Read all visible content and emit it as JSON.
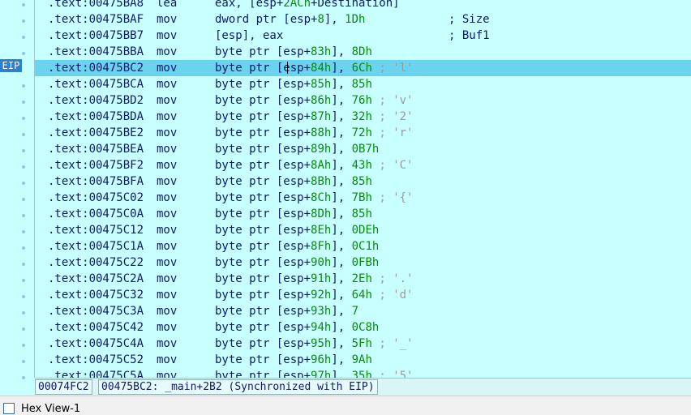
{
  "eip_label": "EIP",
  "rows": [
    {
      "addr": ".text:00475BA8",
      "mn": "lea",
      "ops": [
        {
          "t": "eax, [esp+",
          "c": "reg"
        },
        {
          "t": "2ACh",
          "c": "num"
        },
        {
          "t": "+Destination]",
          "c": "reg"
        }
      ],
      "cmt": ""
    },
    {
      "addr": ".text:00475BAF",
      "mn": "mov",
      "ops": [
        {
          "t": "dword ptr [esp+",
          "c": "reg"
        },
        {
          "t": "8",
          "c": "num"
        },
        {
          "t": "], ",
          "c": "reg"
        },
        {
          "t": "1Dh",
          "c": "num"
        }
      ],
      "far": "; Size"
    },
    {
      "addr": ".text:00475BB7",
      "mn": "mov",
      "ops": [
        {
          "t": "[esp], eax",
          "c": "reg"
        }
      ],
      "far": "; Buf1"
    },
    {
      "addr": ".text:00475BBA",
      "mn": "mov",
      "ops": [
        {
          "t": "byte ptr [esp+",
          "c": "reg"
        },
        {
          "t": "83h",
          "c": "num"
        },
        {
          "t": "], ",
          "c": "reg"
        },
        {
          "t": "8Dh",
          "c": "num"
        }
      ],
      "cmt": ""
    },
    {
      "addr": ".text:00475BC2",
      "mn": "mov",
      "ops": [
        {
          "t": "byte ptr [esp+",
          "c": "reg"
        },
        {
          "t": "84h",
          "c": "num"
        },
        {
          "t": "], ",
          "c": "reg"
        },
        {
          "t": "6Ch",
          "c": "num"
        }
      ],
      "cmt": " ; 'l'",
      "current": true
    },
    {
      "addr": ".text:00475BCA",
      "mn": "mov",
      "ops": [
        {
          "t": "byte ptr [esp+",
          "c": "reg"
        },
        {
          "t": "85h",
          "c": "num"
        },
        {
          "t": "], ",
          "c": "reg"
        },
        {
          "t": "85h",
          "c": "num"
        }
      ],
      "cmt": ""
    },
    {
      "addr": ".text:00475BD2",
      "mn": "mov",
      "ops": [
        {
          "t": "byte ptr [esp+",
          "c": "reg"
        },
        {
          "t": "86h",
          "c": "num"
        },
        {
          "t": "], ",
          "c": "reg"
        },
        {
          "t": "76h",
          "c": "num"
        }
      ],
      "cmt": " ; 'v'"
    },
    {
      "addr": ".text:00475BDA",
      "mn": "mov",
      "ops": [
        {
          "t": "byte ptr [esp+",
          "c": "reg"
        },
        {
          "t": "87h",
          "c": "num"
        },
        {
          "t": "], ",
          "c": "reg"
        },
        {
          "t": "32h",
          "c": "num"
        }
      ],
      "cmt": " ; '2'"
    },
    {
      "addr": ".text:00475BE2",
      "mn": "mov",
      "ops": [
        {
          "t": "byte ptr [esp+",
          "c": "reg"
        },
        {
          "t": "88h",
          "c": "num"
        },
        {
          "t": "], ",
          "c": "reg"
        },
        {
          "t": "72h",
          "c": "num"
        }
      ],
      "cmt": " ; 'r'"
    },
    {
      "addr": ".text:00475BEA",
      "mn": "mov",
      "ops": [
        {
          "t": "byte ptr [esp+",
          "c": "reg"
        },
        {
          "t": "89h",
          "c": "num"
        },
        {
          "t": "], ",
          "c": "reg"
        },
        {
          "t": "0B7h",
          "c": "num"
        }
      ],
      "cmt": ""
    },
    {
      "addr": ".text:00475BF2",
      "mn": "mov",
      "ops": [
        {
          "t": "byte ptr [esp+",
          "c": "reg"
        },
        {
          "t": "8Ah",
          "c": "num"
        },
        {
          "t": "], ",
          "c": "reg"
        },
        {
          "t": "43h",
          "c": "num"
        }
      ],
      "cmt": " ; 'C'"
    },
    {
      "addr": ".text:00475BFA",
      "mn": "mov",
      "ops": [
        {
          "t": "byte ptr [esp+",
          "c": "reg"
        },
        {
          "t": "8Bh",
          "c": "num"
        },
        {
          "t": "], ",
          "c": "reg"
        },
        {
          "t": "85h",
          "c": "num"
        }
      ],
      "cmt": ""
    },
    {
      "addr": ".text:00475C02",
      "mn": "mov",
      "ops": [
        {
          "t": "byte ptr [esp+",
          "c": "reg"
        },
        {
          "t": "8Ch",
          "c": "num"
        },
        {
          "t": "], ",
          "c": "reg"
        },
        {
          "t": "7Bh",
          "c": "num"
        }
      ],
      "cmt": " ; '{'"
    },
    {
      "addr": ".text:00475C0A",
      "mn": "mov",
      "ops": [
        {
          "t": "byte ptr [esp+",
          "c": "reg"
        },
        {
          "t": "8Dh",
          "c": "num"
        },
        {
          "t": "], ",
          "c": "reg"
        },
        {
          "t": "85h",
          "c": "num"
        }
      ],
      "cmt": ""
    },
    {
      "addr": ".text:00475C12",
      "mn": "mov",
      "ops": [
        {
          "t": "byte ptr [esp+",
          "c": "reg"
        },
        {
          "t": "8Eh",
          "c": "num"
        },
        {
          "t": "], ",
          "c": "reg"
        },
        {
          "t": "0DEh",
          "c": "num"
        }
      ],
      "cmt": ""
    },
    {
      "addr": ".text:00475C1A",
      "mn": "mov",
      "ops": [
        {
          "t": "byte ptr [esp+",
          "c": "reg"
        },
        {
          "t": "8Fh",
          "c": "num"
        },
        {
          "t": "], ",
          "c": "reg"
        },
        {
          "t": "0C1h",
          "c": "num"
        }
      ],
      "cmt": ""
    },
    {
      "addr": ".text:00475C22",
      "mn": "mov",
      "ops": [
        {
          "t": "byte ptr [esp+",
          "c": "reg"
        },
        {
          "t": "90h",
          "c": "num"
        },
        {
          "t": "], ",
          "c": "reg"
        },
        {
          "t": "0FBh",
          "c": "num"
        }
      ],
      "cmt": ""
    },
    {
      "addr": ".text:00475C2A",
      "mn": "mov",
      "ops": [
        {
          "t": "byte ptr [esp+",
          "c": "reg"
        },
        {
          "t": "91h",
          "c": "num"
        },
        {
          "t": "], ",
          "c": "reg"
        },
        {
          "t": "2Eh",
          "c": "num"
        }
      ],
      "cmt": " ; '.'"
    },
    {
      "addr": ".text:00475C32",
      "mn": "mov",
      "ops": [
        {
          "t": "byte ptr [esp+",
          "c": "reg"
        },
        {
          "t": "92h",
          "c": "num"
        },
        {
          "t": "], ",
          "c": "reg"
        },
        {
          "t": "64h",
          "c": "num"
        }
      ],
      "cmt": " ; 'd'"
    },
    {
      "addr": ".text:00475C3A",
      "mn": "mov",
      "ops": [
        {
          "t": "byte ptr [esp+",
          "c": "reg"
        },
        {
          "t": "93h",
          "c": "num"
        },
        {
          "t": "], ",
          "c": "reg"
        },
        {
          "t": "7",
          "c": "num"
        }
      ],
      "cmt": ""
    },
    {
      "addr": ".text:00475C42",
      "mn": "mov",
      "ops": [
        {
          "t": "byte ptr [esp+",
          "c": "reg"
        },
        {
          "t": "94h",
          "c": "num"
        },
        {
          "t": "], ",
          "c": "reg"
        },
        {
          "t": "0C8h",
          "c": "num"
        }
      ],
      "cmt": ""
    },
    {
      "addr": ".text:00475C4A",
      "mn": "mov",
      "ops": [
        {
          "t": "byte ptr [esp+",
          "c": "reg"
        },
        {
          "t": "95h",
          "c": "num"
        },
        {
          "t": "], ",
          "c": "reg"
        },
        {
          "t": "5Fh",
          "c": "num"
        }
      ],
      "cmt": " ; '_'"
    },
    {
      "addr": ".text:00475C52",
      "mn": "mov",
      "ops": [
        {
          "t": "byte ptr [esp+",
          "c": "reg"
        },
        {
          "t": "96h",
          "c": "num"
        },
        {
          "t": "], ",
          "c": "reg"
        },
        {
          "t": "9Ah",
          "c": "num"
        }
      ],
      "cmt": ""
    },
    {
      "addr": ".text:00475C5A",
      "mn": "mov",
      "ops": [
        {
          "t": "byte ptr [esp+",
          "c": "reg"
        },
        {
          "t": "97h",
          "c": "num"
        },
        {
          "t": "], ",
          "c": "reg"
        },
        {
          "t": "35h",
          "c": "num"
        }
      ],
      "cmt": " ; '5'"
    }
  ],
  "status": {
    "file_offset": "00074FC2",
    "location": "00475BC2: _main+2B2 (Synchronized with EIP)"
  },
  "bottom_tab": {
    "label": "Hex View-1"
  }
}
